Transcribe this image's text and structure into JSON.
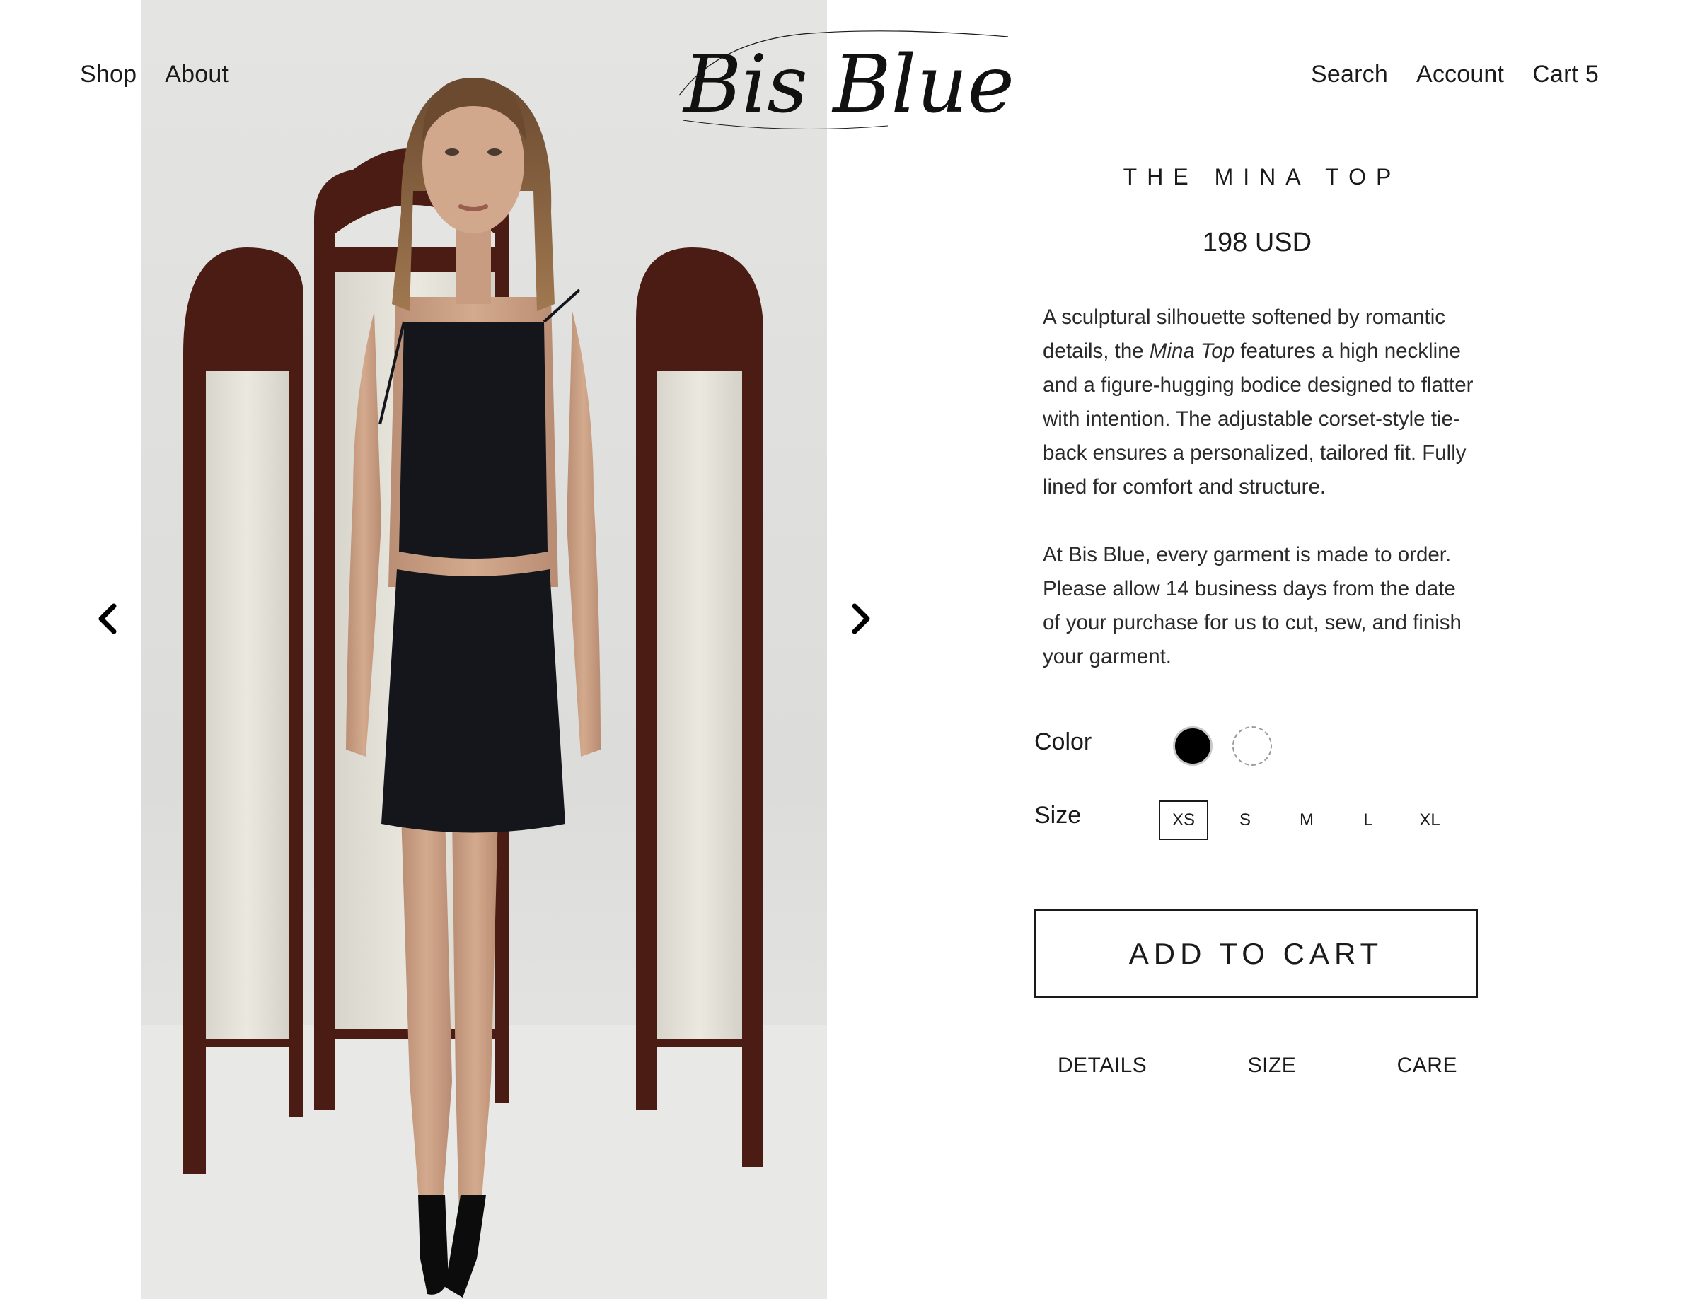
{
  "header": {
    "nav_left": [
      {
        "label": "Shop"
      },
      {
        "label": "About"
      }
    ],
    "logo_text": "Bis Blue",
    "nav_right": [
      {
        "label": "Search"
      },
      {
        "label": "Account"
      },
      {
        "label": "Cart 5"
      }
    ]
  },
  "gallery": {
    "prev_icon": "chevron-left-icon",
    "next_icon": "chevron-right-icon"
  },
  "product": {
    "title": "THE MINA TOP",
    "price": "198 USD",
    "description": {
      "p1_before": "A sculptural silhouette softened by romantic details, the ",
      "p1_italic": "Mina Top",
      "p1_after": " features a high neckline and a figure-hugging bodice designed to flatter with intention. The adjustable corset-style tie-back ensures a personalized, tailored fit. Fully lined for comfort and structure.",
      "p2": "At Bis Blue, every garment is made to order. Please allow 14 business days from the date of your purchase for us to cut, sew, and finish your garment."
    },
    "color_label": "Color",
    "colors": [
      {
        "name": "black",
        "hex": "#000000",
        "selected": true
      },
      {
        "name": "white",
        "hex": "#ffffff",
        "selected": false
      }
    ],
    "size_label": "Size",
    "sizes": [
      "XS",
      "S",
      "M",
      "L",
      "XL"
    ],
    "selected_size": "XS",
    "add_to_cart": "ADD TO CART",
    "tabs": [
      "DETAILS",
      "SIZE",
      "CARE"
    ]
  },
  "colors": {
    "text": "#1a1a1a",
    "background": "#ffffff",
    "screen_wood": "#4a1c14",
    "outfit": "#14161c"
  }
}
